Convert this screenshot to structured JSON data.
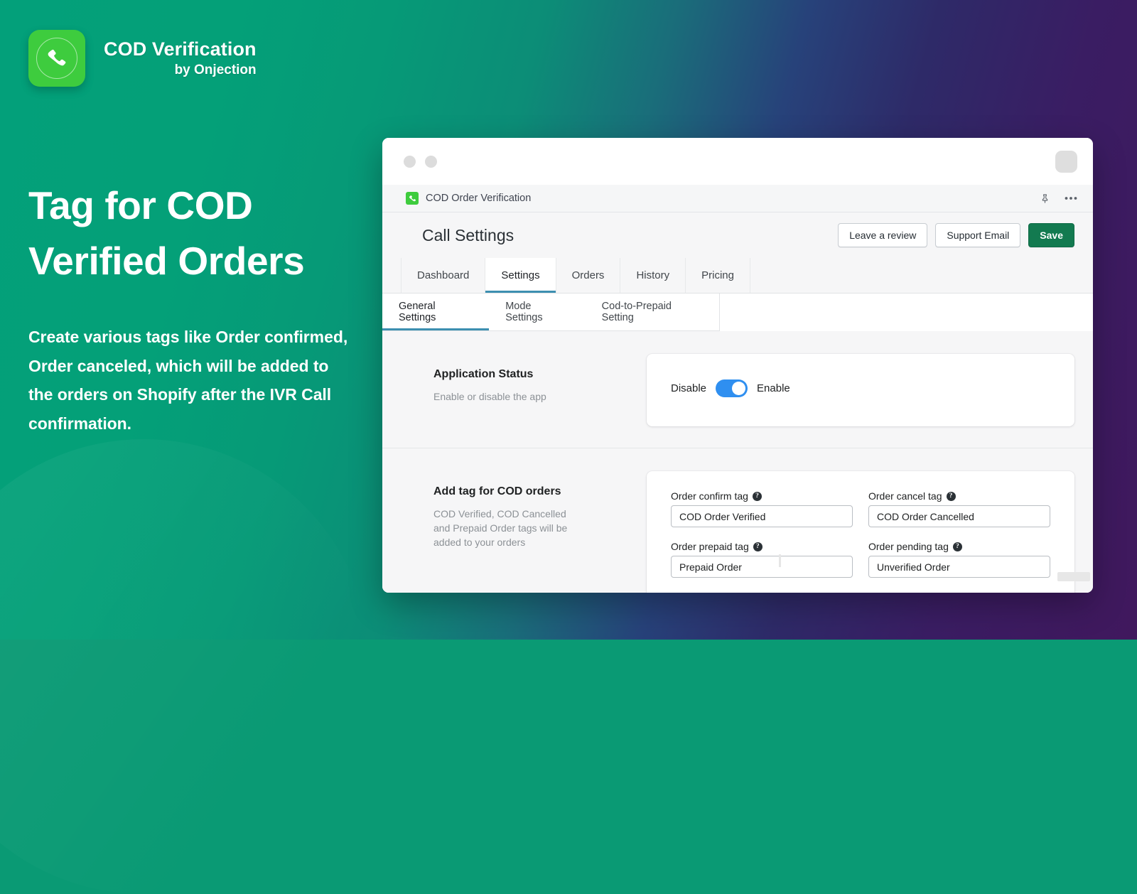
{
  "promo": {
    "brand": {
      "name": "COD Verification",
      "by": "by Onjection",
      "logo_icon": "phone-handset-icon",
      "logo_color": "#3ECC3E"
    },
    "heading": "Tag for COD Verified Orders",
    "body": "Create various tags like Order confirmed, Order canceled, which will be added to the orders on Shopify after the IVR Call confirmation."
  },
  "window": {
    "titlebar": {
      "dots": [
        "window-dot-1",
        "window-dot-2"
      ],
      "avatar_icon": "avatar-placeholder"
    },
    "app_tab": {
      "favicon": "phone-handset-icon",
      "title": "COD Order Verification",
      "pin_icon": "pin-icon",
      "more_icon": "more-horizontal-icon"
    }
  },
  "header": {
    "title": "Call Settings",
    "buttons": [
      {
        "label": "Leave a review",
        "name": "leave-a-review-button",
        "style": "secondary"
      },
      {
        "label": "Support Email",
        "name": "support-email-button",
        "style": "secondary"
      },
      {
        "label": "Save",
        "name": "save-button",
        "style": "primary"
      }
    ],
    "primary_color": "#137A50"
  },
  "tabs": {
    "primary": [
      {
        "label": "Dashboard",
        "active": false
      },
      {
        "label": "Settings",
        "active": true
      },
      {
        "label": "Orders",
        "active": false
      },
      {
        "label": "History",
        "active": false
      },
      {
        "label": "Pricing",
        "active": false
      }
    ],
    "secondary": [
      {
        "label": "General Settings",
        "active": true
      },
      {
        "label": "Mode Settings",
        "active": false
      },
      {
        "label": "Cod-to-Prepaid Setting",
        "active": false
      }
    ],
    "accent_color": "#3D8FB0"
  },
  "sections": {
    "application_status": {
      "title": "Application Status",
      "description": "Enable or disable the app",
      "toggle": {
        "left_label": "Disable",
        "right_label": "Enable",
        "state": "on",
        "color": "#2F8FF0"
      }
    },
    "tags": {
      "title": "Add tag for COD orders",
      "description": "COD Verified, COD Cancelled and Prepaid Order tags will be added to your orders",
      "fields": [
        {
          "label": "Order confirm tag",
          "value": "COD Order Verified",
          "name": "order-confirm-tag-input",
          "help": "?"
        },
        {
          "label": "Order cancel tag",
          "value": "COD Order Cancelled",
          "name": "order-cancel-tag-input",
          "help": "?"
        },
        {
          "label": "Order prepaid tag",
          "value": "Prepaid Order",
          "name": "order-prepaid-tag-input",
          "help": "?"
        },
        {
          "label": "Order pending tag",
          "value": "Unverified Order",
          "name": "order-pending-tag-input",
          "help": "?"
        }
      ]
    }
  },
  "theme": {
    "bg_gradient_start": "#03A07A",
    "bg_gradient_end": "#40185D"
  }
}
